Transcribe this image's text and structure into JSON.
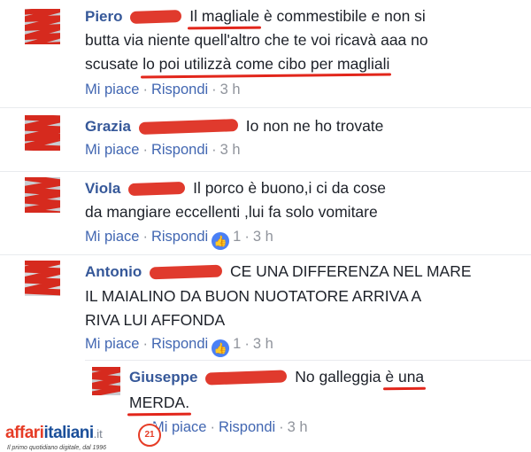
{
  "comments": [
    {
      "name": "Piero",
      "lines": [
        [
          {
            "t": ""
          },
          {
            "t": "Il magliale",
            "u": true
          },
          {
            "t": " è commestibile e non si"
          }
        ],
        [
          {
            "t": "butta via niente quell'altro che te voi ricavà aaa no"
          }
        ],
        [
          {
            "t": "scusate "
          },
          {
            "t": "lo poi utilizzà come cibo per magliali",
            "u": true
          }
        ]
      ],
      "actions": {
        "like": "Mi piace",
        "reply": "Rispondi",
        "time": "3 h",
        "reactions": ""
      }
    },
    {
      "name": "Grazia",
      "lines": [
        [
          {
            "t": "Io non ne ho trovate"
          }
        ]
      ],
      "actions": {
        "like": "Mi piace",
        "reply": "Rispondi",
        "time": "3 h",
        "reactions": ""
      }
    },
    {
      "name": "Viola",
      "lines": [
        [
          {
            "t": "Il porco è buono,i ci da cose"
          }
        ],
        [
          {
            "t": "da mangiare eccellenti ,lui fa solo vomitare"
          }
        ]
      ],
      "actions": {
        "like": "Mi piace",
        "reply": "Rispondi",
        "time": "3 h",
        "reactions": "1"
      }
    },
    {
      "name": "Antonio",
      "lines": [
        [
          {
            "t": "CE UNA DIFFERENZA NEL MARE"
          }
        ],
        [
          {
            "t": "IL MAIALINO DA BUON NUOTATORE ARRIVA A"
          }
        ],
        [
          {
            "t": "RIVA LUI AFFONDA"
          }
        ]
      ],
      "actions": {
        "like": "Mi piace",
        "reply": "Rispondi",
        "time": "3 h",
        "reactions": "1"
      }
    },
    {
      "name": "Giuseppe",
      "lines": [
        [
          {
            "t": "No galleggia "
          },
          {
            "t": "è una",
            "u": true
          }
        ],
        [
          {
            "t": "MERDA.",
            "u": true
          }
        ]
      ],
      "actions": {
        "like": "Mi piace",
        "reply": "Rispondi",
        "time": "3 h",
        "reactions": ""
      }
    }
  ],
  "watermark": {
    "brand_a": "affari",
    "brand_b": "italiani",
    "brand_c": ".it",
    "tagline": "Il primo quotidiano digitale, dal 1996",
    "badge": "21"
  },
  "colors": {
    "name": "#365899",
    "action": "#4267b2",
    "meta": "#90949c",
    "underline": "#e2261b",
    "redaction": "#e03a2d"
  }
}
